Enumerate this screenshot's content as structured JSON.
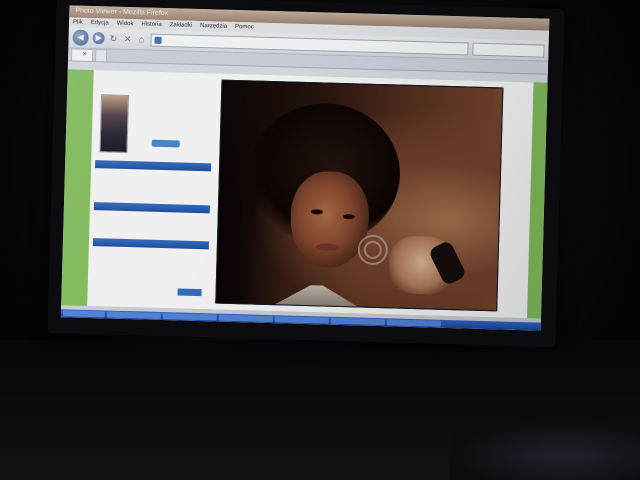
{
  "window": {
    "title": "Photo Viewer - Mozilla Firefox"
  },
  "menu": {
    "items": [
      "Plik",
      "Edycja",
      "Widok",
      "Historia",
      "Zakładki",
      "Narzędzia",
      "Pomoc"
    ]
  },
  "nav": {
    "back_icon": "arrow-left-icon",
    "forward_icon": "arrow-right-icon",
    "reload_icon": "reload-icon",
    "stop_icon": "stop-icon",
    "home_icon": "home-icon"
  },
  "tabs": [],
  "sidebar": {
    "links": [],
    "product": {
      "name": "",
      "price": "",
      "button": ""
    },
    "sections": [],
    "footer_button": ""
  },
  "photo": {
    "subject": ""
  },
  "taskbar": {
    "items": []
  },
  "colors": {
    "page_background": "#8bc765",
    "sidebar_header": "#2f64b8",
    "taskbar": "#2a5cbd"
  }
}
